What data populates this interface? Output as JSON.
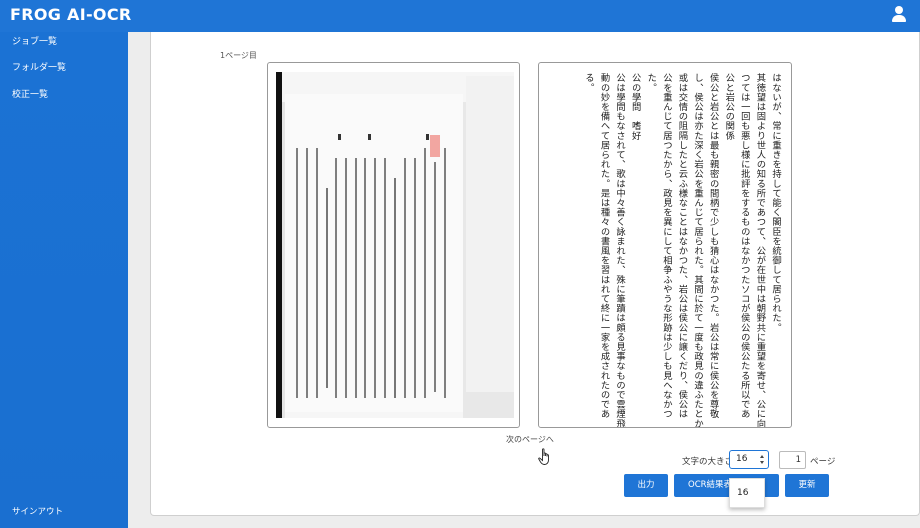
{
  "app": {
    "title": "FROG AI-OCR"
  },
  "header": {
    "user_icon": "user-icon"
  },
  "sidebar": {
    "items": [
      {
        "label": "ジョブ一覧"
      },
      {
        "label": "フォルダ一覧"
      },
      {
        "label": "校正一覧"
      }
    ],
    "signout_label": "サインアウト"
  },
  "viewer": {
    "page_label": "1ページ目",
    "next_page_label": "次のページへ",
    "ocr_text": "はないが、常に重きを持して能く閣臣を統御して居られた。\n其徳望は固より世人の知る所であつて、公が在世中は朝野共に重望を寄せ、公に向\nつては一回も悪し様に批評をするものはなかつたソコが侯公の侯公たる所以であ\n公と岩公の関係\n侯公と岩公とは最も親密の間柄で少しも猜心はなかつた。岩公は常に侯公を尊敬\nし、侯公は亦た深く岩公を重んじて居られた。其間に於て一度も政見の違ふたとか\n或は交情の阻隔したと云ふ様なことはなかつた、岩公は侯公に譲くだり、侯公は\n公を重んじて居つたから、政見を異にして相争ふやうな形跡は少しも見へなかつ\nた。\n公の學問　嗜好\n公は學問もなされて、歌は中々善く詠まれた、殊に筆蹟は頗る見事なもので雲煙飛\n動の妙を備へて居られた。是は種々の書風を習はれて終に一家を成されたのであ\nる。"
  },
  "controls": {
    "font_size_label": "文字の大きさ",
    "font_size_value": "16",
    "font_size_options": [
      "16"
    ],
    "page_input_value": "1",
    "page_unit_label": "ページ",
    "export_button_label": "出力",
    "ocr_result_button_label": "OCR結果表",
    "update_button_label": "更新"
  },
  "colors": {
    "accent": "#1f75d6",
    "panel_bg": "#ffffff",
    "page_bg": "#ededed"
  }
}
